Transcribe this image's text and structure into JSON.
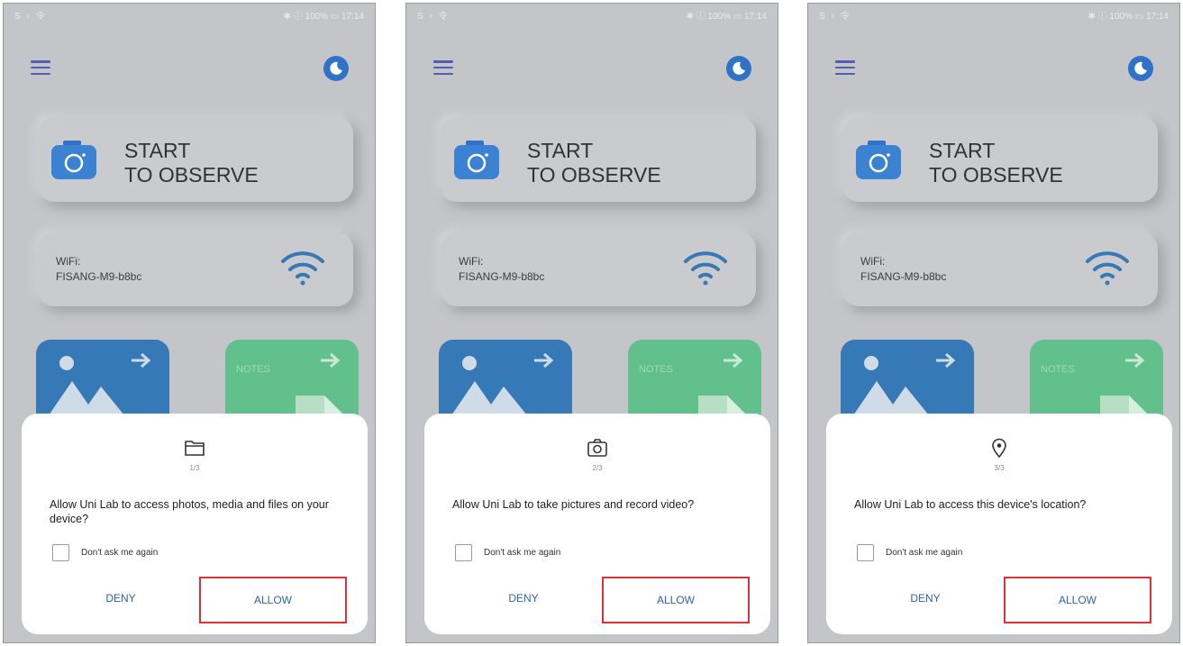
{
  "status_bar": {
    "left": "S ♀ 令",
    "right": "✱ ⓘ 100% ▭ 17:14"
  },
  "main": {
    "start_line1": "START",
    "start_line2": "TO OBSERVE",
    "wifi_label": "WiFi:",
    "wifi_ssid": "FISANG-M9-b8bc",
    "notes_label": "NOTES"
  },
  "colors": {
    "background": "#c3c5c8",
    "accent_blue": "#3579b6",
    "notes_green": "#62c08d",
    "highlight_red": "#e0303a",
    "button_text": "#2f62b0"
  },
  "dialogs": [
    {
      "icon": "folder-icon",
      "step": "1/3",
      "message": "Allow Uni Lab to access photos, media and files on your device?",
      "checkbox_label": "Don't ask me again",
      "deny": "DENY",
      "allow": "ALLOW"
    },
    {
      "icon": "camera-icon",
      "step": "2/3",
      "message": "Allow Uni Lab to take pictures and record video?",
      "checkbox_label": "Don't ask me again",
      "deny": "DENY",
      "allow": "ALLOW"
    },
    {
      "icon": "location-icon",
      "step": "3/3",
      "message": "Allow Uni Lab to access this device's location?",
      "checkbox_label": "Don't ask me again",
      "deny": "DENY",
      "allow": "ALLOW"
    }
  ]
}
